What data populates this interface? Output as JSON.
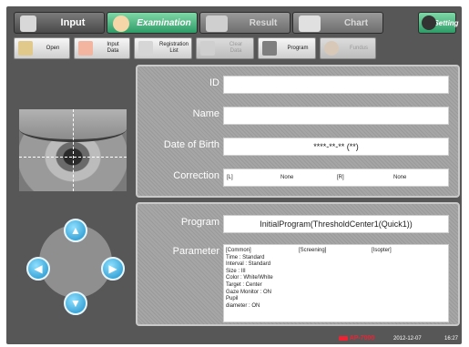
{
  "tabs": {
    "input": "Input",
    "examination": "Examination",
    "result": "Result",
    "chart": "Chart",
    "setting": "Setting"
  },
  "subbar": {
    "open": "Open",
    "input_data": "Input\nData",
    "registration_list": "Registration\nList",
    "clear_data": "Clear\nData",
    "program": "Program",
    "fundus": "Fundus"
  },
  "patient": {
    "id_label": "ID",
    "id_value": "",
    "name_label": "Name",
    "name_value": "",
    "dob_label": "Date of Birth",
    "dob_value": "****-**-** (**)",
    "correction_label": "Correction",
    "correction_left_tag": "[L]",
    "correction_left_value": "None",
    "correction_right_tag": "[R]",
    "correction_right_value": "None"
  },
  "program": {
    "program_label": "Program",
    "program_value": "InitialProgram(ThresholdCenter1(Quick1))",
    "parameter_label": "Parameter",
    "col_common": "[Common]",
    "col_screening": "[Screening]",
    "col_isopter": "[Isopter]",
    "common_lines": [
      "Time : Standard",
      "Interval : Standard",
      "Size : ΙΙΙ",
      "Color : White/White",
      "Target : Center",
      "Gaze Monitor : ON",
      "Pupil",
      "diameter : ON"
    ]
  },
  "footer": {
    "model": "AP-7000",
    "date": "2012-12-07",
    "time": "16:27"
  },
  "colors": {
    "frame": "#575757",
    "accent_green": "#2e9c67",
    "arrow_blue": "#1b8fc8"
  }
}
